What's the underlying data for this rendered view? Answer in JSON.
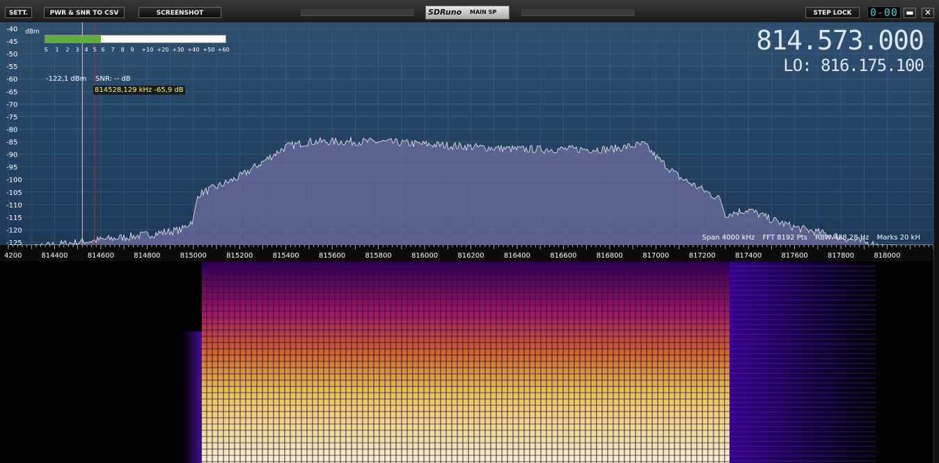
{
  "toolbar": {
    "sett_label": "SETT.",
    "pwr_snr_label": "PWR & SNR TO CSV",
    "screenshot_label": "SCREENSHOT",
    "logo_brand": "SDRuno",
    "logo_panel": "MAIN SP",
    "step_lock_label": "STEP LOCK",
    "seg_display": "0-00",
    "minimize_label": "▬",
    "close_label": "✕"
  },
  "display": {
    "frequency": "814.573.000",
    "lo_frequency": "LO: 816.175.100"
  },
  "meter": {
    "unit": "dBm",
    "scale": [
      "S",
      "1",
      "2",
      "3",
      "4",
      "5",
      "6",
      "7",
      "8",
      "9",
      "+10",
      "+20",
      "+30",
      "+40",
      "+50",
      "+60"
    ],
    "fill_fraction": 0.31
  },
  "readout": {
    "level": "-122,1 dBm",
    "snr": "SNR: -- dB",
    "cursor": "814528,129 kHz -65,9 dB"
  },
  "stats": {
    "span": "Span 4000 kHz",
    "fft": "FFT 8192 Pts",
    "rbw": "RBW 488,28 Hz",
    "marks": "Marks 20 kH"
  },
  "colors": {
    "trace": "#e0e0e0",
    "fill": "#6e6ea0",
    "grid": "#5a6fa8",
    "cursor_red": "#e02020",
    "cursor_white": "#cfcfcf",
    "meter_green": "#5fb03c"
  },
  "chart_data": {
    "type": "area",
    "xlabel": "",
    "ylabel": "",
    "xlim": [
      814200,
      818200
    ],
    "ylim": [
      -125,
      -40
    ],
    "y_ticks": [
      -40,
      -45,
      -50,
      -55,
      -60,
      -65,
      -70,
      -75,
      -80,
      -85,
      -90,
      -95,
      -100,
      -105,
      -110,
      -115,
      -120,
      -125
    ],
    "x_tick_labels": [
      "4200",
      "814400",
      "814600",
      "814800",
      "815000",
      "815200",
      "815400",
      "815600",
      "815800",
      "816000",
      "816200",
      "816400",
      "816600",
      "816800",
      "817000",
      "817200",
      "817400",
      "817600",
      "817800",
      "818000"
    ],
    "x_ticks": [
      814200,
      814400,
      814600,
      814800,
      815000,
      815200,
      815400,
      815600,
      815800,
      816000,
      816200,
      816400,
      816600,
      816800,
      817000,
      817200,
      817400,
      817600,
      817800,
      818000
    ],
    "series": [
      {
        "x": [
          814200,
          814400,
          814600,
          814800,
          814950,
          815000,
          815020,
          815100,
          815200,
          815300,
          815400,
          815500,
          815600,
          815800,
          816000,
          816200,
          816400,
          816600,
          816800,
          816950,
          817000,
          817100,
          817200,
          817280,
          817300,
          817400,
          817500,
          817600,
          817700,
          817800,
          817900,
          818000,
          818200
        ],
        "y": [
          -129,
          -126,
          -124,
          -122,
          -120,
          -116,
          -106,
          -103,
          -99,
          -93,
          -87,
          -85,
          -85,
          -85,
          -86,
          -87,
          -88,
          -88,
          -88,
          -86,
          -91,
          -99,
          -104,
          -108,
          -114,
          -112,
          -116,
          -119,
          -121,
          -123,
          -125,
          -127,
          -130
        ]
      }
    ],
    "cursor_white_x": 814520,
    "cursor_red_x": 814573,
    "grid": true
  }
}
